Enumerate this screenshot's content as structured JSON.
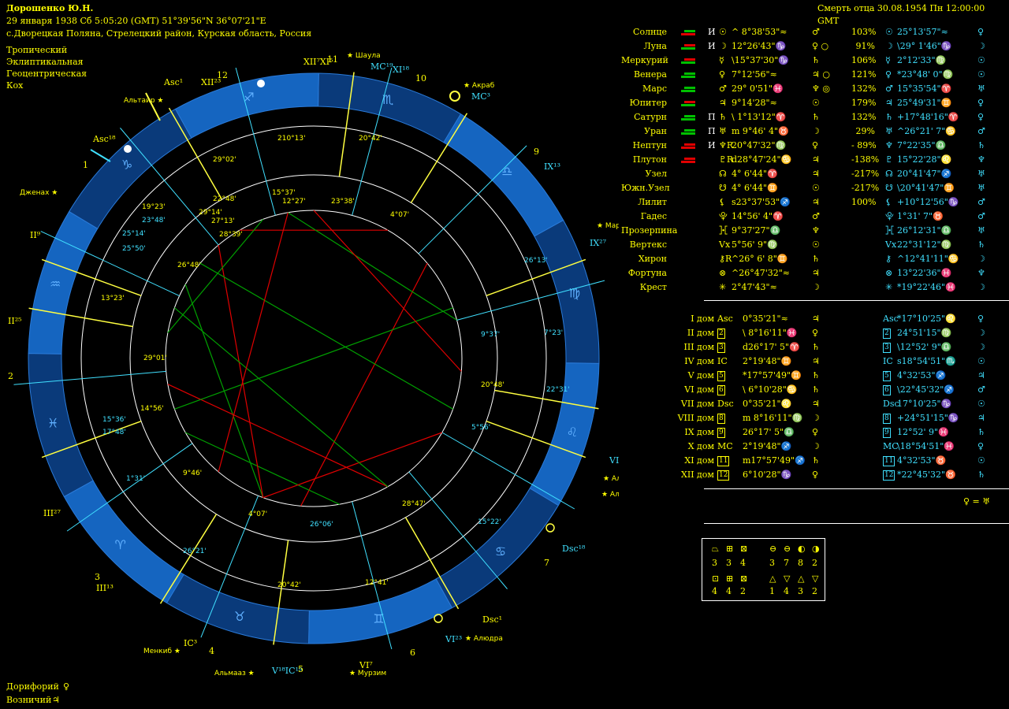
{
  "header": {
    "name": "Дорошенко Ю.Н.",
    "date_line": "29 января 1938  Сб   5:05:20 (GMT) 51°39'56\"N  36°07'21\"E",
    "place": "с.Дворецкая Поляна, Стрелецкий район, Курская область, Россия",
    "zodiac": "Тропический",
    "coords": "Эклиптикальная",
    "center": "Геоцентрическая",
    "houses": "Кох",
    "event": "Смерть отца 30.08.1954  Пн 12:00:00 GMT"
  },
  "planets": [
    {
      "name": "Солнце",
      "mark": "И",
      "sym": "☉",
      "pos": "^ 8°38'53\"≈",
      "ruler": "♂",
      "pct": "103%",
      "t_sym": "☉",
      "t_pos": "25°13'57\"≈",
      "t_ruler": "♀",
      "bars": [
        "#00c000",
        "#e00000"
      ]
    },
    {
      "name": "Луна",
      "mark": "И",
      "sym": "☽",
      "pos": "12°26'43\"♑",
      "ruler": "♀ ○",
      "pct": "91%",
      "t_sym": "☽",
      "t_pos": "\\29° 1'46\"♑",
      "t_ruler": "☽",
      "bars": [
        "#e00000",
        "#00c000"
      ]
    },
    {
      "name": "Меркурий",
      "mark": "",
      "sym": "☿",
      "pos": "\\15°37'30\"♑",
      "ruler": "♄",
      "pct": "106%",
      "t_sym": "☿",
      "t_pos": "2°12'33\"♍",
      "t_ruler": "☉",
      "bars": [
        "#e00000",
        "#00c000"
      ]
    },
    {
      "name": "Венера",
      "mark": "",
      "sym": "♀",
      "pos": "7°12'56\"≈",
      "ruler": "♃ ○",
      "pct": "121%",
      "t_sym": "♀",
      "t_pos": "*23°48' 0\"♍",
      "t_ruler": "☉",
      "bars": [
        "#00c000",
        "#00c000"
      ]
    },
    {
      "name": "Марс",
      "mark": "",
      "sym": "♂",
      "pos": "29° 0'51\"♓",
      "ruler": "♆ ◎",
      "pct": "132%",
      "t_sym": "♂",
      "t_pos": "15°35'54\"♈",
      "t_ruler": "♅",
      "bars": [
        "#00c000",
        "#00c000"
      ]
    },
    {
      "name": "Юпитер",
      "mark": "",
      "sym": "♃",
      "pos": "9°14'28\"≈",
      "ruler": "☉",
      "pct": "179%",
      "t_sym": "♃",
      "t_pos": "25°49'31\"♊",
      "t_ruler": "♀",
      "bars": [
        "#e00000",
        "#00c000"
      ]
    },
    {
      "name": "Сатурн",
      "mark": "П",
      "sym": "♄",
      "pos": "\\ 1°13'12\"♈",
      "ruler": "♄",
      "pct": "132%",
      "t_sym": "♄",
      "t_pos": "+17°48'16\"♈",
      "t_ruler": "♀",
      "bars": [
        "#00c000",
        "#00c000"
      ]
    },
    {
      "name": "Уран",
      "mark": "П",
      "sym": "♅",
      "pos": "m 9°46' 4\"♉",
      "ruler": "☽",
      "pct": "29%",
      "t_sym": "♅",
      "t_pos": "^26°21' 7\"♋",
      "t_ruler": "♂",
      "bars": [
        "#00c000",
        "#00c000"
      ]
    },
    {
      "name": "Нептун",
      "mark": "И",
      "sym": "♆R",
      "pos": "20°47'32\"♍",
      "ruler": "♀",
      "pct": "- 89%",
      "t_sym": "♆",
      "t_pos": "7°22'35\"♎",
      "t_ruler": "♄",
      "bars": [
        "#e00000",
        "#e00000"
      ]
    },
    {
      "name": "Плутон",
      "mark": "",
      "sym": "♇R",
      "pos": "d28°47'24\"♋",
      "ruler": "♃",
      "pct": "-138%",
      "t_sym": "♇",
      "t_pos": "15°22'28\"♌",
      "t_ruler": "♆",
      "bars": [
        "#e00000",
        "#e00000"
      ]
    },
    {
      "name": "Узел",
      "mark": "",
      "sym": "☊",
      "pos": "4° 6'44\"♈",
      "ruler": "♃",
      "pct": "-217%",
      "t_sym": "☊",
      "t_pos": "20°41'47\"♐",
      "t_ruler": "♅",
      "bars": []
    },
    {
      "name": "Южн.Узел",
      "mark": "",
      "sym": "☋",
      "pos": "4° 6'44\"♊",
      "ruler": "☉",
      "pct": "-217%",
      "t_sym": "☋",
      "t_pos": "\\20°41'47\"♊",
      "t_ruler": "♅",
      "bars": []
    },
    {
      "name": "Лилит",
      "mark": "",
      "sym": "⚸",
      "pos": "s23°37'53\"♐",
      "ruler": "♃",
      "pct": "100%",
      "t_sym": "⚸",
      "t_pos": "+10°12'56\"♑",
      "t_ruler": "♂",
      "bars": []
    },
    {
      "name": "Гадес",
      "mark": "",
      "sym": "⯓",
      "pos": "14°56' 4\"♈",
      "ruler": "♂",
      "pct": "",
      "t_sym": "⯓",
      "t_pos": "1°31' 7\"♉",
      "t_ruler": "♂",
      "bars": []
    },
    {
      "name": "Прозерпина",
      "mark": "",
      "sym": "⯘",
      "pos": "9°37'27\"♎",
      "ruler": "♆",
      "pct": "",
      "t_sym": "⯘",
      "t_pos": "26°12'31\"♎",
      "t_ruler": "♅",
      "bars": []
    },
    {
      "name": "Вертекс",
      "mark": "",
      "sym": "Vx",
      "pos": "5°56' 9\"♍",
      "ruler": "☉",
      "pct": "",
      "t_sym": "Vx",
      "t_pos": "22°31'12\"♍",
      "t_ruler": "♄",
      "bars": []
    },
    {
      "name": "Хирон",
      "mark": "",
      "sym": "⚷R",
      "pos": "^26° 6' 8\"♊",
      "ruler": "♄",
      "pct": "",
      "t_sym": "⚷",
      "t_pos": "^12°41'11\"♋",
      "t_ruler": "☽",
      "bars": []
    },
    {
      "name": "Фортуна",
      "mark": "",
      "sym": "⊗",
      "pos": "^26°47'32\"≈",
      "ruler": "♃",
      "pct": "",
      "t_sym": "⊗",
      "t_pos": "13°22'36\"♓",
      "t_ruler": "♆",
      "bars": []
    },
    {
      "name": "Крест",
      "mark": "",
      "sym": "✳",
      "pos": "2°47'43\"≈",
      "ruler": "☽",
      "pct": "",
      "t_sym": "✳",
      "t_pos": "*19°22'46\"♓",
      "t_ruler": "☽",
      "bars": []
    }
  ],
  "houses": [
    {
      "name": "I дом",
      "sym": "Asc",
      "pos": "0°35'21\"≈",
      "ruler": "♃",
      "t_sym": "Asc",
      "t_pos": "*17°10'25\"♌",
      "t_ruler": "♀"
    },
    {
      "name": "II дом",
      "sym": "2",
      "pos": "\\ 8°16'11\"♓",
      "ruler": "♀",
      "t_sym": "2",
      "t_pos": "24°51'15\"♍",
      "t_ruler": "☽"
    },
    {
      "name": "III дом",
      "sym": "3",
      "pos": "d26°17' 5\"♈",
      "ruler": "♄",
      "t_sym": "3",
      "t_pos": "\\12°52' 9\"♎",
      "t_ruler": "☽"
    },
    {
      "name": "IV дом",
      "sym": "IC",
      "pos": "2°19'48\"♊",
      "ruler": "♃",
      "t_sym": "IC",
      "t_pos": "s18°54'51\"♏",
      "t_ruler": "☉"
    },
    {
      "name": "V дом",
      "sym": "5",
      "pos": "*17°57'49\"♊",
      "ruler": "♄",
      "t_sym": "5",
      "t_pos": "4°32'53\"♐",
      "t_ruler": "♃"
    },
    {
      "name": "VI дом",
      "sym": "6",
      "pos": "\\ 6°10'28\"♋",
      "ruler": "♄",
      "t_sym": "6",
      "t_pos": "\\22°45'32\"♐",
      "t_ruler": "♂"
    },
    {
      "name": "VII дом",
      "sym": "Dsc",
      "pos": "0°35'21\"♌",
      "ruler": "♃",
      "t_sym": "Dsc",
      "t_pos": "17°10'25\"♑",
      "t_ruler": "☉"
    },
    {
      "name": "VIII дом",
      "sym": "8",
      "pos": "m 8°16'11\"♍",
      "ruler": "☽",
      "t_sym": "8",
      "t_pos": "+24°51'15\"♑",
      "t_ruler": "♃"
    },
    {
      "name": "IX дом",
      "sym": "9",
      "pos": "26°17' 5\"♎",
      "ruler": "♀",
      "t_sym": "9",
      "t_pos": "12°52' 9\"♓",
      "t_ruler": "♄"
    },
    {
      "name": "X дом",
      "sym": "MC",
      "pos": "2°19'48\"♐",
      "ruler": "☽",
      "t_sym": "MC",
      "t_pos": "\\18°54'51\"♓",
      "t_ruler": "♀"
    },
    {
      "name": "XI дом",
      "sym": "11",
      "pos": "m17°57'49\"♐",
      "ruler": "♄",
      "t_sym": "11",
      "t_pos": "4°32'53\"♉",
      "t_ruler": "☉"
    },
    {
      "name": "XII дом",
      "sym": "12",
      "pos": "6°10'28\"♑",
      "ruler": "♀",
      "t_sym": "12",
      "t_pos": "*22°45'32\"♉",
      "t_ruler": "♄"
    }
  ],
  "extra_line": "♀ = ♅",
  "elements": {
    "row1_syms": [
      "⏢",
      "⊞",
      "⊠",
      "⊖",
      "⊖",
      "◐",
      "◑"
    ],
    "row1_nums": [
      "3",
      "3",
      "4",
      "3",
      "7",
      "8",
      "2"
    ],
    "row2_syms": [
      "⊡",
      "⊞",
      "⊠",
      "△",
      "▽",
      "△",
      "▽"
    ],
    "row2_nums": [
      "4",
      "4",
      "2",
      "1",
      "4",
      "3",
      "2"
    ]
  },
  "footer": {
    "doriforiy": "Дорифорий",
    "doriforiy_sym": "♀",
    "voznichiy": "Возничий",
    "voznichiy_sym": "♃"
  },
  "wheel": {
    "signs": [
      "♒",
      "♓",
      "♈",
      "♉",
      "♊",
      "♋",
      "♌",
      "♍",
      "♎",
      "♏",
      "♐",
      "♑"
    ],
    "house_numbers": [
      "1",
      "2",
      "3",
      "4",
      "5",
      "6",
      "7",
      "8",
      "9",
      "10",
      "11",
      "12"
    ],
    "outer_labels": [
      {
        "t": "Asc¹"
      },
      {
        "t": "Asc¹⁸"
      },
      {
        "t": "XII²³"
      },
      {
        "t": "XII⁷XI⁵"
      },
      {
        "t": "MC¹⁹"
      },
      {
        "t": "XI¹⁸"
      },
      {
        "t": "MC³"
      },
      {
        "t": "IX¹³"
      },
      {
        "t": "IX²⁷"
      },
      {
        "t": "VIII²⁵"
      },
      {
        "t": "VIII⁹"
      },
      {
        "t": "Dsc¹⁸"
      },
      {
        "t": "Dsc¹"
      },
      {
        "t": "VI²³"
      },
      {
        "t": "V¹⁸IC¹⁹"
      },
      {
        "t": "VI⁷"
      },
      {
        "t": "IC³"
      },
      {
        "t": "III¹³"
      },
      {
        "t": "III²⁷"
      },
      {
        "t": "II²⁵"
      },
      {
        "t": "II⁹"
      }
    ],
    "stars": [
      {
        "t": "Альтаир ★"
      },
      {
        "t": "Дженах ★"
      },
      {
        "t": "★ Шаула"
      },
      {
        "t": "★ Акраб"
      },
      {
        "t": "★ Маркеб"
      },
      {
        "t": "★ Денебола"
      },
      {
        "t": "★ Алиот"
      },
      {
        "t": "★ Алюла Бореалис"
      },
      {
        "t": "★ Алюдра"
      },
      {
        "t": "★ Мурзим"
      },
      {
        "t": "Альмааз ★"
      },
      {
        "t": "Менкиб ★"
      }
    ],
    "inner_labels": [
      "29°02'",
      "22°48'",
      "29°14'",
      "27°13'",
      "28°39'",
      "210°13'",
      "15°37'",
      "12°27'",
      "23°38'",
      "20°42'",
      "4°07'",
      "19°23'",
      "23°48'",
      "25°14'",
      "25°50'",
      "26°48'",
      "13°23'",
      "29°01'",
      "14°56'",
      "15°36'",
      "17°48'",
      "1°31'",
      "9°46'",
      "26°21'",
      "4°07'",
      "20°42'",
      "26°06'",
      "12°41'",
      "28°47'",
      "15°22'",
      "5°56'",
      "22°31'",
      "20°48'",
      "7°23'",
      "9°37'",
      "26°13'"
    ]
  }
}
